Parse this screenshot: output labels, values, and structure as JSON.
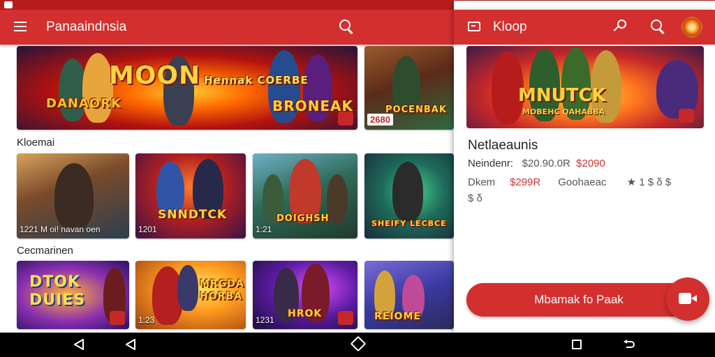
{
  "left_pane": {
    "app_title": "Panaaindnsia",
    "featured": [
      {
        "logo_line1": "MOON",
        "logo_line2": "DANAORK",
        "logo_line3": "BRONEAK",
        "logo_line4": "Hennak COERBE"
      },
      {
        "logo": "POCENBAK",
        "price": "2680"
      }
    ],
    "section1_label": "Kloemai",
    "section1_cards": [
      {
        "caption": "1221 M oi! navan oen"
      },
      {
        "caption": "1201",
        "logo": "SNNDTCK"
      },
      {
        "caption": "1:21",
        "logo": "DOIGHSH"
      },
      {
        "logo": "SHEIFY LECBCE"
      }
    ],
    "section2_label": "Cecmarinen",
    "section2_cards": [
      {
        "logo": "DTOK DUIES"
      },
      {
        "caption": "1:23",
        "logo": "MRGDA HORBA"
      },
      {
        "caption": "1231",
        "logo": "HROK"
      },
      {
        "logo": "REIOME"
      }
    ]
  },
  "right_pane": {
    "title": "Kloop",
    "hero_logo": "MNUTCK",
    "hero_logo_sub": "MOBEHC QAHABBA",
    "detail_title": "Netlaeaunis",
    "row1_label": "Neindenr:",
    "row1_value_old": "$20.90.0R",
    "row1_value_new": "$2090",
    "row2_label": "Dkem",
    "row2_value": "$299R",
    "row2_mid": "Goohaeac",
    "row2_rating": "★ 1 $ δ $",
    "row3_value": "$ δ",
    "cta_label": "Mbamak fo Paak"
  },
  "icons": {
    "menu": "hamburger-icon",
    "search": "search-icon",
    "folder": "folder-icon",
    "pen": "pen-icon",
    "fab": "camera-icon"
  },
  "colors": {
    "primary": "#d32f2f",
    "status_bar": "#b71c1c"
  }
}
